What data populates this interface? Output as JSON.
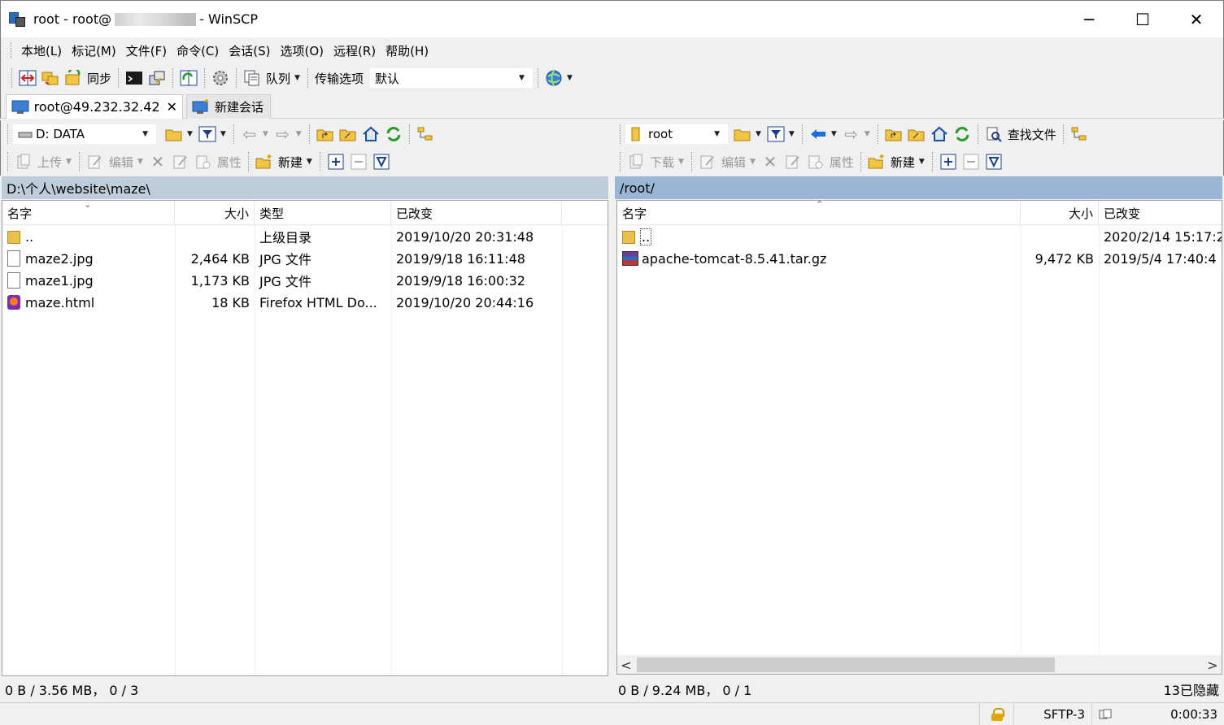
{
  "window": {
    "title_prefix": "root - root@",
    "title_suffix": "- WinSCP",
    "minimize": "─",
    "maximize": "☐",
    "close": "✕"
  },
  "menu": [
    "本地(L)",
    "标记(M)",
    "文件(F)",
    "命令(C)",
    "会话(S)",
    "选项(O)",
    "远程(R)",
    "帮助(H)"
  ],
  "toolbar": {
    "sync_label": "同步",
    "queue_label": "队列",
    "transfer_options_label": "传输选项",
    "transfer_preset": "默认"
  },
  "tabs": {
    "active_label": "root@49.232.32.42",
    "close_glyph": "✕",
    "new_session_label": "新建会话"
  },
  "left_panel": {
    "drive": "D: DATA",
    "upload_label": "上传",
    "edit_label": "编辑",
    "properties_label": "属性",
    "new_label": "新建",
    "path": "D:\\个人\\website\\maze\\",
    "columns": {
      "name": "名字",
      "size": "大小",
      "type": "类型",
      "changed": "已改变"
    },
    "rows": [
      {
        "icon": "parent-folder-icon",
        "name": "..",
        "size": "",
        "type": "上级目录",
        "changed": "2019/10/20  20:31:48"
      },
      {
        "icon": "file-icon",
        "name": "maze2.jpg",
        "size": "2,464 KB",
        "type": "JPG 文件",
        "changed": "2019/9/18  16:11:48"
      },
      {
        "icon": "file-icon",
        "name": "maze1.jpg",
        "size": "1,173 KB",
        "type": "JPG 文件",
        "changed": "2019/9/18  16:00:32"
      },
      {
        "icon": "firefox-icon",
        "name": "maze.html",
        "size": "18 KB",
        "type": "Firefox HTML Do...",
        "changed": "2019/10/20  20:44:16"
      }
    ],
    "status": "0 B / 3.56 MB，  0 / 3"
  },
  "right_panel": {
    "folder": "root",
    "download_label": "下载",
    "edit_label": "编辑",
    "properties_label": "属性",
    "new_label": "新建",
    "find_files_label": "查找文件",
    "path": "/root/",
    "columns": {
      "name": "名字",
      "size": "大小",
      "changed": "已改变"
    },
    "rows": [
      {
        "icon": "parent-folder-icon",
        "name": "..",
        "size": "",
        "changed": "2020/2/14 15:17:2"
      },
      {
        "icon": "archive-icon",
        "name": "apache-tomcat-8.5.41.tar.gz",
        "size": "9,472 KB",
        "changed": "2019/5/4 17:40:4"
      }
    ],
    "status": "0 B / 9.24 MB，  0 / 1",
    "hidden_count": "13已隐藏"
  },
  "statusbar": {
    "protocol": "SFTP-3",
    "elapsed": "0:00:33"
  }
}
